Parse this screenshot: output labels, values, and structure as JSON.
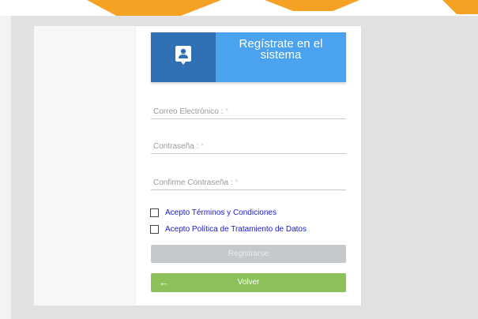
{
  "header": {
    "title_line1": "Regístrate en el",
    "title_line2": "sistema",
    "icon": "contact-card-icon"
  },
  "form": {
    "email_label": "Correo Electrónico :",
    "password_label": "Contraseña :",
    "confirm_password_label": "Confirme Contraseña :",
    "required_mark": "*"
  },
  "checkboxes": {
    "terms_label": "Acepto Términos y Condiciones",
    "privacy_label": "Acepto Política de Tratamiento de Datos"
  },
  "buttons": {
    "register_label": "Registrarse",
    "back_label": "Volver",
    "back_arrow": "←"
  },
  "colors": {
    "header_blue": "#4ba3f0",
    "header_icon_blue": "#2f6fb4",
    "back_green": "#8cc15a",
    "register_disabled": "#c5c9cc",
    "accent_orange": "#f4a124"
  }
}
